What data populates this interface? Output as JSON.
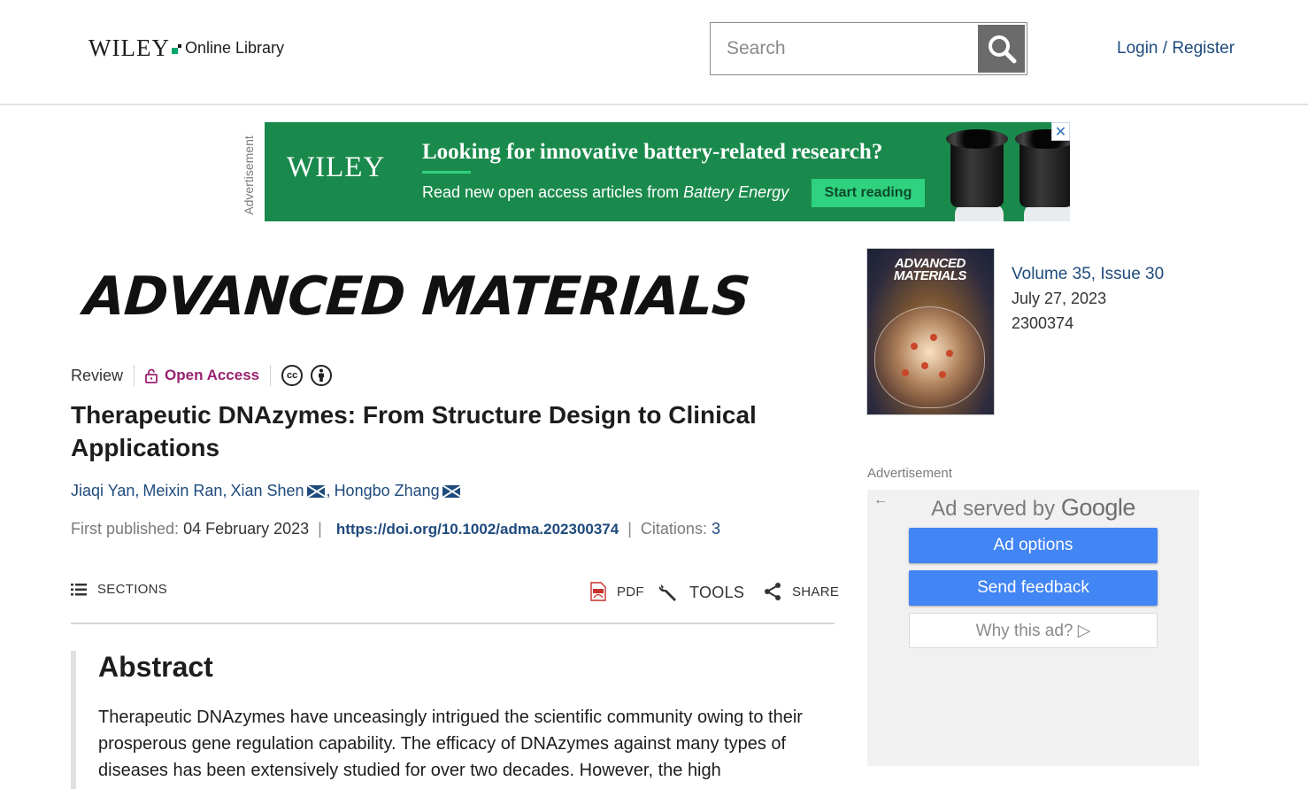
{
  "header": {
    "logo_main": "WILEY",
    "logo_sub": "Online Library",
    "search_placeholder": "Search",
    "search_icon": "search-icon",
    "login_label": "Login / Register"
  },
  "top_ad": {
    "vertical_label": "Advertisement",
    "brand": "WILEY",
    "headline": "Looking for innovative battery-related research?",
    "subline_prefix": "Read new open access articles from ",
    "subline_journal": "Battery Energy",
    "cta": "Start reading",
    "close": "✕",
    "colors": {
      "background": "#1a8a4c",
      "cta": "#2fd27f"
    }
  },
  "journal": {
    "name": "ADVANCED MATERIALS"
  },
  "article": {
    "type": "Review",
    "access": "Open Access",
    "license_cc": "cc",
    "title": "Therapeutic DNAzymes: From Structure Design to Clinical Applications",
    "authors": [
      {
        "name": "Jiaqi Yan",
        "email": false
      },
      {
        "name": "Meixin Ran",
        "email": false
      },
      {
        "name": "Xian Shen",
        "email": true
      },
      {
        "name": "Hongbo Zhang",
        "email": true
      }
    ],
    "first_published_label": "First published:",
    "first_published_date": "04 February 2023",
    "doi": "https://doi.org/10.1002/adma.202300374",
    "citations_label": "Citations:",
    "citations_count": "3"
  },
  "toolbar": {
    "sections": "SECTIONS",
    "pdf": "PDF",
    "tools": "TOOLS",
    "share": "SHARE"
  },
  "abstract": {
    "heading": "Abstract",
    "text": "Therapeutic DNAzymes have unceasingly intrigued the scientific community owing to their prosperous gene regulation capability. The efficacy of DNAzymes against many types of diseases has been extensively studied for over two decades. However, the high"
  },
  "issue": {
    "cover_title_line1": "ADVANCED",
    "cover_title_line2": "MATERIALS",
    "volume": "Volume 35, Issue 30",
    "date": "July 27, 2023",
    "number": "2300374"
  },
  "side_ad": {
    "label": "Advertisement",
    "served_by_prefix": "Ad served by ",
    "served_by_brand": "Google",
    "buttons": [
      "Ad options",
      "Send feedback",
      "Why this ad? ▷"
    ],
    "colors": {
      "button_blue": "#4285f4"
    }
  },
  "colors": {
    "link": "#1e4a7c",
    "open_access": "#9a2270",
    "wiley_green": "#00a66c"
  }
}
